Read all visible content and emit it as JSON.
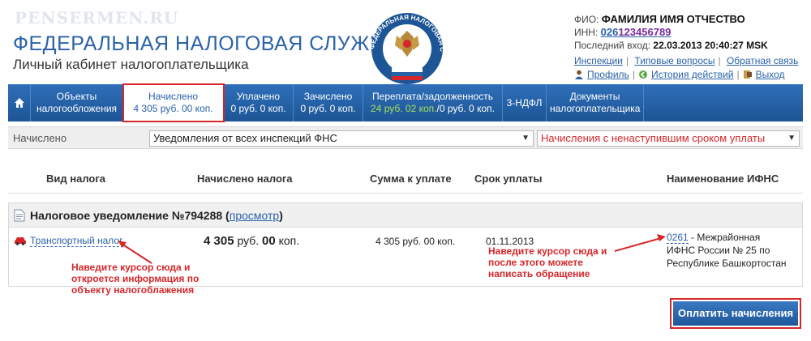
{
  "watermark": "PENSERMEN.RU",
  "header": {
    "title": "ФЕДЕРАЛЬНАЯ НАЛОГОВАЯ СЛУЖБА",
    "subtitle": "Личный кабинет налогоплательщика",
    "emblem_text": "ФЕДЕРАЛЬНАЯ НАЛОГОВАЯ СЛУЖБА"
  },
  "user": {
    "fio_label": "ФИО:",
    "fio": "ФАМИЛИЯ ИМЯ ОТЧЕСТВО",
    "inn_label": "ИНН:",
    "inn_prefix": "026",
    "inn_rest": "123456789",
    "last_login_label": "Последний вход:",
    "last_login": "22.03.2013 20:40:27 MSK"
  },
  "links": {
    "inspections": "Инспекции",
    "faq": "Типовые вопросы",
    "feedback": "Обратная связь",
    "profile": "Профиль",
    "history": "История действий",
    "logout": "Выход"
  },
  "nav": {
    "home_icon": "home-icon",
    "items": [
      {
        "label": "Объекты",
        "sub": "налогообложения"
      },
      {
        "label": "Начислено",
        "sub": "4 305 руб. 00 коп."
      },
      {
        "label": "Уплачено",
        "sub": "0 руб. 0 коп."
      },
      {
        "label": "Зачислено",
        "sub": "0 руб. 0 коп."
      },
      {
        "label": "Переплата/задолженность",
        "sub_green": "24 руб. 02 коп.",
        "sub": "/0 руб. 0 коп."
      },
      {
        "label": "3-НДФЛ",
        "sub": ""
      },
      {
        "label": "Документы",
        "sub": "налогоплательщика"
      }
    ]
  },
  "filter": {
    "label": "Начислено",
    "select1": "Уведомления от всех инспекций ФНС",
    "select2": "Начисления с ненаступившим сроком уплаты"
  },
  "table": {
    "headers": [
      "Вид налога",
      "Начислено налога",
      "Сумма к уплате",
      "Срок уплаты",
      "Наименование ИФНС"
    ]
  },
  "notice": {
    "title": "Налоговое уведомление №794288",
    "view_link": "просмотр",
    "row": {
      "tax": "Транспортный налог",
      "accrued_rub": "4 305",
      "accrued_rub_unit": "руб.",
      "accrued_kop": "00",
      "accrued_kop_unit": "коп.",
      "to_pay": "4 305 руб. 00 коп.",
      "due_date": "01.11.2013",
      "ifns_code": "0261",
      "ifns_name": " - Межрайонная ИФНС России № 25 по Республике Башкортостан"
    }
  },
  "annotations": {
    "left": "Наведите курсор сюда и откроется информация по объекту налогоблажения",
    "right": "Наведите курсор сюда и после этого можете написать обращение"
  },
  "pay_button": "Оплатить начисления",
  "colors": {
    "brand_blue": "#2a62a8",
    "highlight_red": "#d6262a",
    "overpay_green": "#a4e05a"
  }
}
